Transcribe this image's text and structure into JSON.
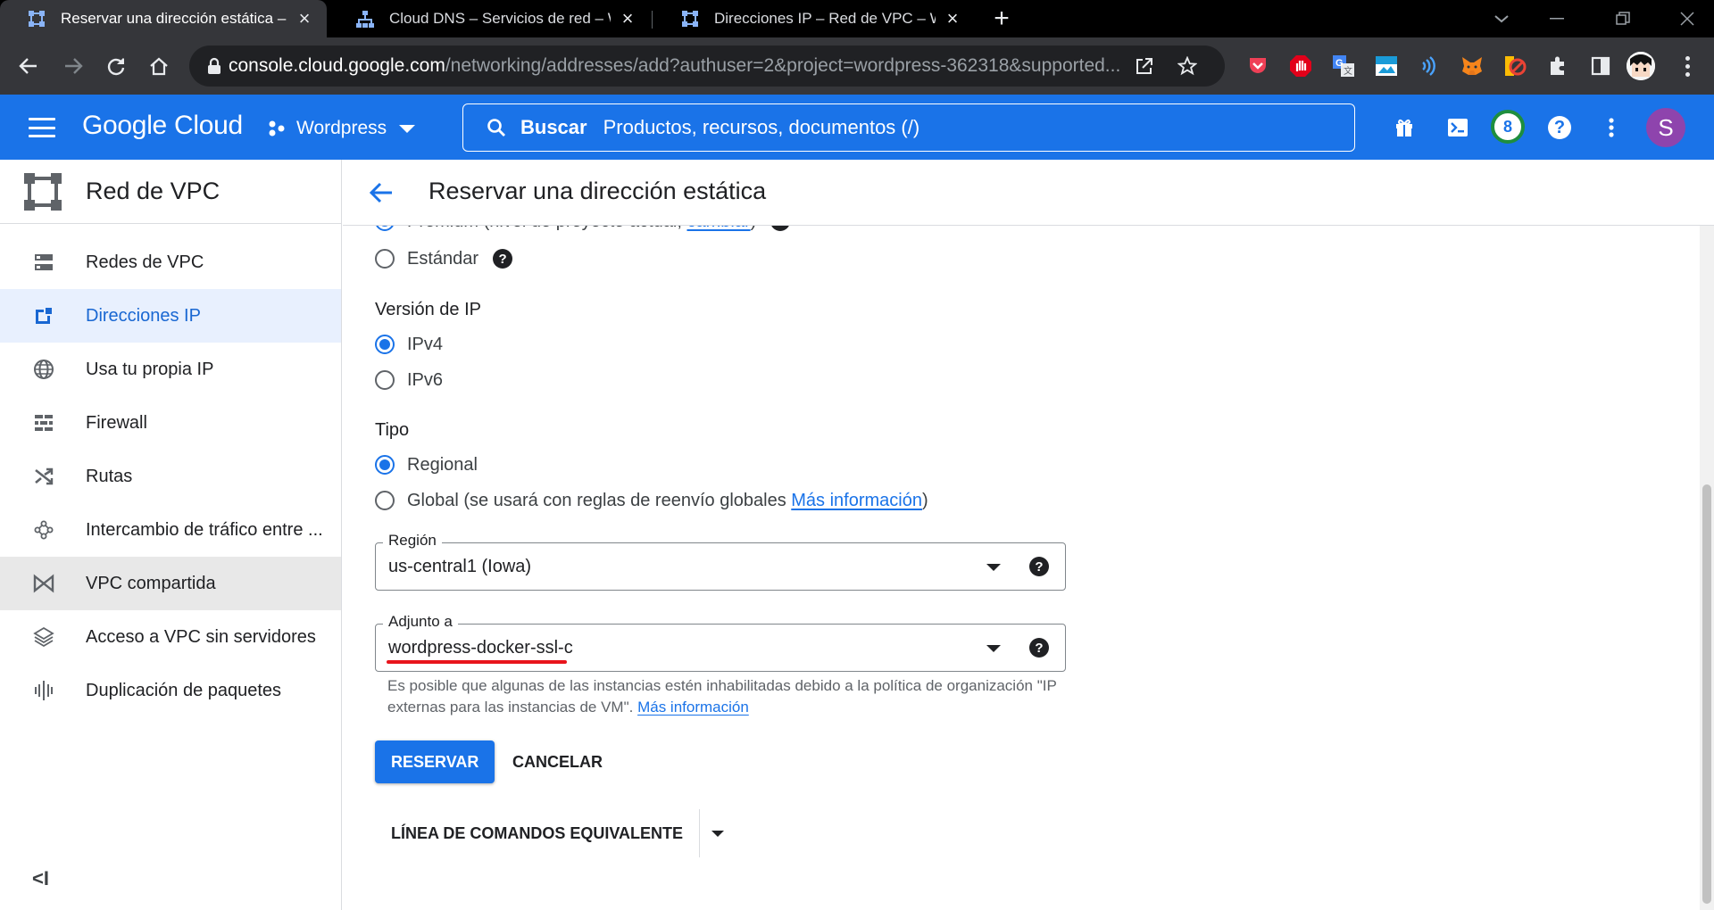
{
  "browser": {
    "tabs": [
      {
        "title": "Reservar una dirección estática –",
        "active": true
      },
      {
        "title": "Cloud DNS – Servicios de red – W",
        "active": false
      },
      {
        "title": "Direcciones IP – Red de VPC – W",
        "active": false
      }
    ],
    "url_host": "console.cloud.google.com",
    "url_path": "/networking/addresses/add?authuser=2&project=wordpress-362318&supported..."
  },
  "header": {
    "logo": "Google Cloud",
    "project": "Wordpress",
    "search_label": "Buscar",
    "search_placeholder": "Productos, recursos, documentos (/)",
    "notifications_count": "8",
    "avatar_letter": "S"
  },
  "sidebar": {
    "title": "Red de VPC",
    "items": [
      {
        "label": "Redes de VPC",
        "icon": "vpc-networks-icon"
      },
      {
        "label": "Direcciones IP",
        "icon": "ip-address-icon",
        "active": true
      },
      {
        "label": "Usa tu propia IP",
        "icon": "globe-icon"
      },
      {
        "label": "Firewall",
        "icon": "firewall-icon"
      },
      {
        "label": "Rutas",
        "icon": "routes-icon"
      },
      {
        "label": "Intercambio de tráfico entre ...",
        "icon": "peering-icon"
      },
      {
        "label": "VPC compartida",
        "icon": "shared-vpc-icon"
      },
      {
        "label": "Acceso a VPC sin servidores",
        "icon": "serverless-icon"
      },
      {
        "label": "Duplicación de paquetes",
        "icon": "packet-mirroring-icon"
      }
    ],
    "collapse": "<I"
  },
  "page": {
    "title": "Reservar una dirección estática",
    "tier_premium": "Premium (nivel de proyecto actual,",
    "tier_premium_link": "cambiar",
    "tier_premium_close": ")",
    "tier_standard": "Estándar",
    "ip_version_label": "Versión de IP",
    "ipv4": "IPv4",
    "ipv6": "IPv6",
    "type_label": "Tipo",
    "type_regional": "Regional",
    "type_global": "Global (se usará con reglas de reenvío globales",
    "type_global_link": "Más información",
    "type_global_close": ")",
    "region_label": "Región",
    "region_value": "us-central1 (Iowa)",
    "attached_label": "Adjunto a",
    "attached_value": "wordpress-docker-ssl-c",
    "hint_text": "Es posible que algunas de las instancias estén inhabilitadas debido a la política de organización \"IP externas para las instancias de VM\".",
    "hint_link": "Más información",
    "reserve_button": "RESERVAR",
    "cancel_button": "CANCELAR",
    "command_line_button": "LÍNEA DE COMANDOS EQUIVALENTE"
  },
  "colors": {
    "brand_blue": "#1a73e8",
    "highlight_red": "#e8141c",
    "sidebar_active_bg": "#e8f0fe"
  }
}
